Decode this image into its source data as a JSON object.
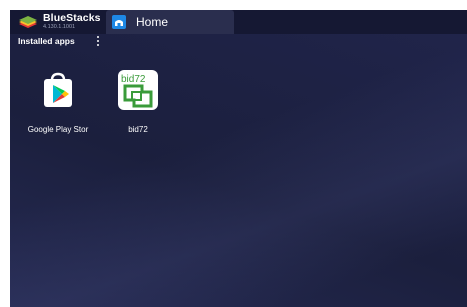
{
  "window": {
    "brand_name": "BlueStacks",
    "brand_version": "4.130.1.1001",
    "tab_label": "Home"
  },
  "installed": {
    "title": "Installed apps",
    "apps": [
      {
        "label": "Google Play Stor",
        "icon": "google-play-store-icon"
      },
      {
        "label": "bid72",
        "icon": "bid72-app-icon",
        "icon_text": "bid72"
      }
    ]
  },
  "colors": {
    "background": "#1c1f3c",
    "topbar": "#151833",
    "tab": "#2a2e4e",
    "accent_blue": "#1e88e5",
    "bid72_green": "#3a9b3a"
  }
}
